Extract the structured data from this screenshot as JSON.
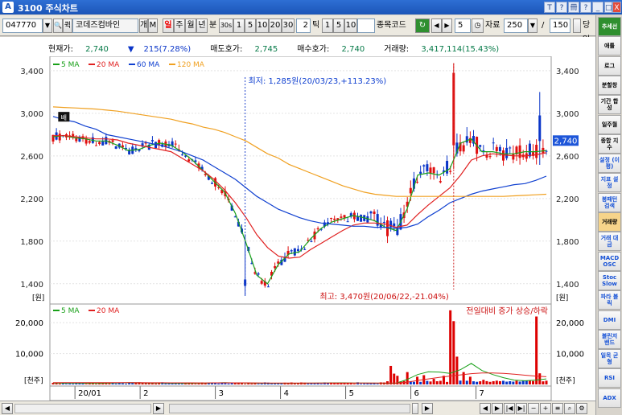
{
  "window": {
    "title": "3100 주식차트"
  },
  "titlebar_buttons": [
    "T",
    "?",
    "冊",
    "?",
    "_",
    "□",
    "X"
  ],
  "toolbar": {
    "code": "047770",
    "name": "코데즈컴바인",
    "btn_ge": "개",
    "btn_m": "M",
    "periods": [
      "일",
      "주",
      "월",
      "년",
      "분",
      "30s",
      "1",
      "5",
      "10",
      "20",
      "30"
    ],
    "tick_value": "2",
    "tick_label": "틱",
    "tick_options": [
      "1",
      "5",
      "10"
    ],
    "stock_code_label": "종목코드",
    "step_value": "5",
    "data_label": "자료",
    "data_value": "250",
    "slash": "/",
    "total_value": "150",
    "dang_label": "당일"
  },
  "info": {
    "price_label": "현재가:",
    "price": "2,740",
    "change_arrow": "▼",
    "change": "215(7.28%)",
    "ask_label": "매도호가:",
    "ask": "2,745",
    "bid_label": "매수호가:",
    "bid": "2,740",
    "volume_label": "거래량:",
    "volume": "3,417,114(15.43%)"
  },
  "legend_main": [
    {
      "label": "5 MA",
      "color": "#19a019"
    },
    {
      "label": "20 MA",
      "color": "#e02020"
    },
    {
      "label": "60 MA",
      "color": "#1040d0"
    },
    {
      "label": "120 MA",
      "color": "#f0a020"
    }
  ],
  "legend_vol": [
    {
      "label": "5 MA",
      "color": "#19a019"
    },
    {
      "label": "20 MA",
      "color": "#e02020"
    }
  ],
  "annotations": {
    "low": "최저: 1,285원(20/03/23,+113.23%)",
    "high": "최고: 3,470원(20/06/22,-21.04%)",
    "vol_note": "전일대비 증가 상승/하락",
    "badge": "배"
  },
  "price_axis": {
    "ticks": [
      "3,400",
      "3,000",
      "2,600",
      "2,200",
      "1,800",
      "1,400"
    ],
    "unit": "[원]",
    "current": "2,740"
  },
  "volume_axis": {
    "ticks": [
      "20,000",
      "10,000"
    ],
    "unit": "[천주]"
  },
  "x_axis": {
    "labels": [
      "20/01",
      "2",
      "3",
      "4",
      "5",
      "6",
      "7"
    ]
  },
  "right_panel": [
    "추세선",
    "애틀",
    "로그",
    "분할창",
    "기간 합성",
    "일주월",
    "종합 지수",
    "설정 (이평)",
    "지표 설정",
    "봉패턴 검색",
    "거래량",
    "거래 대금",
    "MACD OSC",
    "Stoc Slow",
    "파라 볼릭",
    "DMI",
    "볼린저 밴드",
    "일목 균형",
    "RSI",
    "ADX"
  ],
  "colors": {
    "up": "#d11",
    "down": "#0a35c8",
    "ma5": "#19a019",
    "ma20": "#e02020",
    "ma60": "#1040d0",
    "ma120": "#f0a020"
  },
  "chart_data": {
    "type": "candlestick",
    "y_range": [
      1270,
      3520
    ],
    "x_range_dates": [
      "2020-01-02",
      "2020-07-10"
    ],
    "price_series": [
      {
        "name": "5 MA",
        "color": "#19a019",
        "values": [
          2780,
          2790,
          2770,
          2760,
          2740,
          2740,
          2700,
          2650,
          2660,
          2700,
          2720,
          2700,
          2640,
          2560,
          2460,
          2360,
          2260,
          2060,
          1780,
          1480,
          1400,
          1580,
          1680,
          1700,
          1820,
          1920,
          1980,
          2010,
          2040,
          2020,
          1990,
          1930,
          1900,
          2100,
          2420,
          2440,
          2420,
          2480,
          2720,
          2760,
          2640,
          2640,
          2620,
          2620,
          2640,
          2640,
          2650
        ]
      },
      {
        "name": "20 MA",
        "color": "#e02020",
        "values": [
          2790,
          2790,
          2780,
          2770,
          2760,
          2760,
          2750,
          2720,
          2700,
          2680,
          2660,
          2640,
          2580,
          2520,
          2460,
          2380,
          2280,
          2160,
          2020,
          1860,
          1740,
          1660,
          1640,
          1650,
          1720,
          1780,
          1840,
          1900,
          1950,
          1970,
          1970,
          1960,
          1930,
          1950,
          2050,
          2140,
          2220,
          2300,
          2420,
          2560,
          2600,
          2620,
          2610,
          2600,
          2600,
          2610,
          2630
        ]
      },
      {
        "name": "60 MA",
        "color": "#1040d0",
        "values": [
          2970,
          2940,
          2920,
          2880,
          2850,
          2800,
          2780,
          2760,
          2740,
          2720,
          2700,
          2670,
          2640,
          2600,
          2560,
          2500,
          2440,
          2380,
          2300,
          2220,
          2160,
          2100,
          2060,
          2020,
          1990,
          1970,
          1960,
          1950,
          1940,
          1940,
          1930,
          1930,
          1920,
          1930,
          1960,
          2030,
          2090,
          2160,
          2200,
          2240,
          2270,
          2290,
          2310,
          2330,
          2340,
          2370,
          2410
        ]
      },
      {
        "name": "120 MA",
        "color": "#f0a020",
        "values": [
          3060,
          3055,
          3050,
          3045,
          3040,
          3030,
          3020,
          3005,
          2990,
          2975,
          2960,
          2945,
          2920,
          2900,
          2870,
          2850,
          2820,
          2780,
          2740,
          2680,
          2620,
          2580,
          2520,
          2480,
          2440,
          2400,
          2360,
          2320,
          2290,
          2260,
          2240,
          2230,
          2220,
          2220,
          2220,
          2220,
          2220,
          2220,
          2220,
          2220,
          2220,
          2220,
          2220,
          2225,
          2230,
          2235,
          2240
        ]
      }
    ],
    "volume_ma": [
      {
        "name": "5 MA",
        "color": "#19a019",
        "values": [
          500,
          400,
          450,
          380,
          350,
          420,
          500,
          600,
          550,
          480,
          430,
          380,
          360,
          380,
          420,
          500,
          560,
          500,
          480,
          420,
          400,
          380,
          380,
          390,
          420,
          450,
          500,
          520,
          480,
          460,
          420,
          400,
          380,
          1600,
          3200,
          4100,
          4000,
          3600,
          4800,
          6800,
          4500,
          3200,
          2200,
          1400,
          1200,
          1400,
          1800
        ]
      },
      {
        "name": "20 MA",
        "color": "#e02020",
        "values": [
          600,
          600,
          590,
          580,
          570,
          560,
          560,
          560,
          560,
          550,
          540,
          530,
          520,
          510,
          500,
          510,
          520,
          520,
          510,
          490,
          470,
          460,
          450,
          440,
          440,
          440,
          450,
          460,
          470,
          470,
          470,
          460,
          450,
          700,
          1300,
          1800,
          2300,
          2700,
          3100,
          3500,
          3700,
          3700,
          3600,
          3300,
          3000,
          2700,
          2500
        ]
      }
    ],
    "candles": "daily OHLC bars drawn by script from price series with deterministic noise",
    "volumes_note": "daily volume in thousand shares; spikes near late May and late June"
  }
}
